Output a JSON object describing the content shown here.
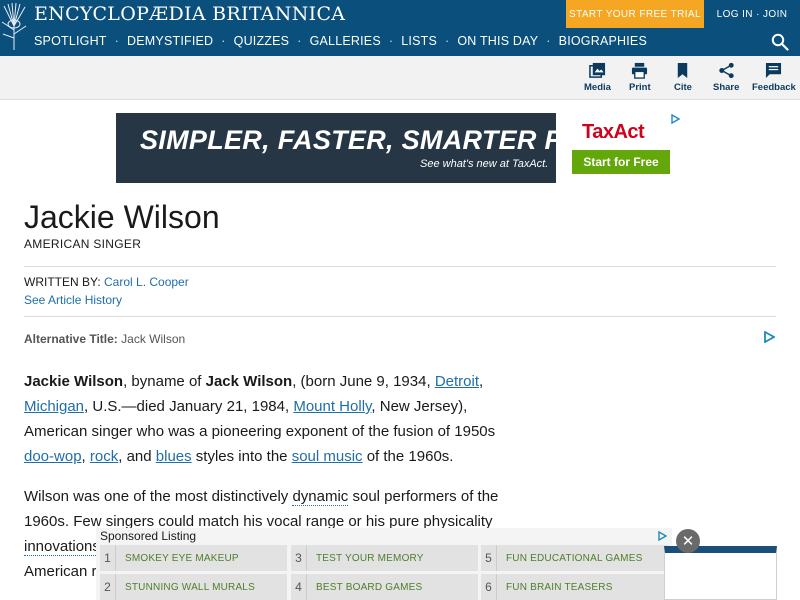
{
  "header": {
    "brand": "ENCYCLOPÆDIA BRITANNICA",
    "trial_label": "START YOUR FREE TRIAL",
    "login_label": "LOG IN · JOIN",
    "nav": [
      "SPOTLIGHT",
      "DEMYSTIFIED",
      "QUIZZES",
      "GALLERIES",
      "LISTS",
      "ON THIS DAY",
      "BIOGRAPHIES"
    ],
    "search_icon": "search-icon"
  },
  "toolbar": {
    "media": "Media",
    "print": "Print",
    "cite": "Cite",
    "share": "Share",
    "feedback": "Feedback"
  },
  "ad": {
    "headline": "SIMPLER, FASTER, SMARTER FILING.",
    "sub": "See what's new at TaxAct.",
    "logo": "TaxAct",
    "cta": "Start for Free"
  },
  "article": {
    "title": "Jackie Wilson",
    "subtitle": "AMERICAN SINGER",
    "written_by_label": "WRITTEN BY:",
    "author": "Carol L. Cooper",
    "history_link": "See Article History",
    "alt_title_label": "Alternative Title:",
    "alt_title_value": "Jack Wilson",
    "p1": {
      "name": "Jackie Wilson",
      "t1": ", byname of ",
      "byname": "Jack Wilson",
      "t2": ", (born June 9, 1934, ",
      "link1": "Detroit",
      "t3": ",",
      "link2": "Michigan",
      "t4": ", U.S.—died January 21, 1984, ",
      "link3": "Mount Holly",
      "t5": ", New Jersey), American singer who was a pioneering exponent of the fusion of 1950s",
      "link4": "doo-wop",
      "t6": ", ",
      "link5": "rock",
      "t7": ", and ",
      "link6": "blues",
      "t8": " styles into the ",
      "link7": "soul music",
      "t9": " of the 1960s."
    },
    "p2": {
      "t1": "Wilson was one of the most distinctively ",
      "link1": "dynamic",
      "t2": " soul performers of the 1960s. Few singers could match his vocal range or his pure physicality",
      "link2": "innovations",
      "t3": "American r"
    }
  },
  "sponsored": {
    "title": "Sponsored Listing",
    "items": [
      {
        "num": "1",
        "label": "SMOKEY EYE MAKEUP"
      },
      {
        "num": "2",
        "label": "STUNNING WALL MURALS"
      },
      {
        "num": "3",
        "label": "TEST YOUR MEMORY"
      },
      {
        "num": "4",
        "label": "BEST BOARD GAMES"
      },
      {
        "num": "5",
        "label": "FUN EDUCATIONAL GAMES"
      },
      {
        "num": "6",
        "label": "FUN BRAIN TEASERS"
      }
    ],
    "close_label": "✕"
  }
}
